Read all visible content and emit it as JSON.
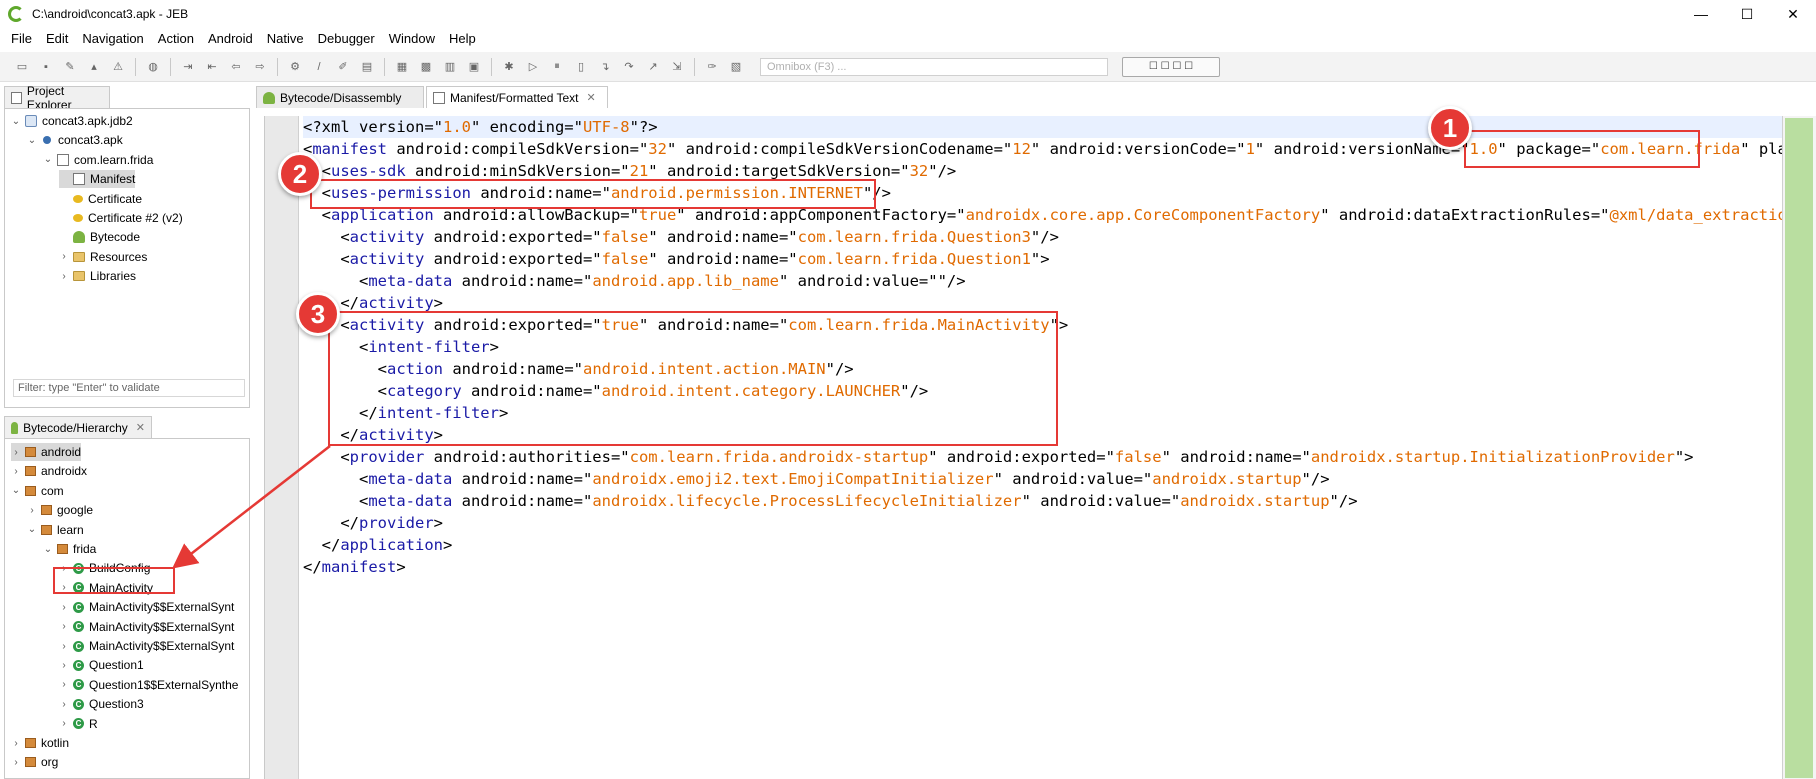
{
  "window": {
    "title": "C:\\android\\concat3.apk - JEB",
    "minimize": "—",
    "maximize": "☐",
    "close": "✕"
  },
  "menu": [
    "File",
    "Edit",
    "Navigation",
    "Action",
    "Android",
    "Native",
    "Debugger",
    "Window",
    "Help"
  ],
  "toolbar": {
    "omnibox_placeholder": "Omnibox (F3) ...",
    "button_label": "☐ ☐ ☐ ☐"
  },
  "project_explorer": {
    "tab_label": "Project Explorer",
    "filter_placeholder": "Filter: type \"Enter\" to validate",
    "items": [
      {
        "label": "concat3.apk.jdb2",
        "icon": "db-icon",
        "depth": 0,
        "chevron": "v"
      },
      {
        "label": "concat3.apk",
        "icon": "apk-icon",
        "depth": 1,
        "chevron": "v"
      },
      {
        "label": "com.learn.frida",
        "icon": "file-icon",
        "depth": 2,
        "chevron": "v"
      },
      {
        "label": "Manifest",
        "icon": "manifest-icon",
        "depth": 3,
        "chevron": "",
        "selected": true
      },
      {
        "label": "Certificate",
        "icon": "certificate-icon",
        "depth": 3,
        "chevron": ""
      },
      {
        "label": "Certificate #2 (v2)",
        "icon": "certificate-icon",
        "depth": 3,
        "chevron": ""
      },
      {
        "label": "Bytecode",
        "icon": "android-icon",
        "depth": 3,
        "chevron": ""
      },
      {
        "label": "Resources",
        "icon": "folder-icon",
        "depth": 3,
        "chevron": ">"
      },
      {
        "label": "Libraries",
        "icon": "folder-icon",
        "depth": 3,
        "chevron": ">"
      }
    ]
  },
  "hierarchy": {
    "tab_label": "Bytecode/Hierarchy",
    "items": [
      {
        "label": "android",
        "icon": "package-icon",
        "depth": 0,
        "chevron": ">",
        "selected": true
      },
      {
        "label": "androidx",
        "icon": "package-icon",
        "depth": 0,
        "chevron": ">"
      },
      {
        "label": "com",
        "icon": "package-icon",
        "depth": 0,
        "chevron": "v"
      },
      {
        "label": "google",
        "icon": "package-icon",
        "depth": 1,
        "chevron": ">"
      },
      {
        "label": "learn",
        "icon": "package-icon",
        "depth": 1,
        "chevron": "v"
      },
      {
        "label": "frida",
        "icon": "package-icon",
        "depth": 2,
        "chevron": "v"
      },
      {
        "label": "BuildConfig",
        "icon": "class-icon",
        "depth": 3,
        "chevron": ">"
      },
      {
        "label": "MainActivity",
        "icon": "class-icon",
        "depth": 3,
        "chevron": ">"
      },
      {
        "label": "MainActivity$$ExternalSynt",
        "icon": "class-icon",
        "depth": 3,
        "chevron": ">"
      },
      {
        "label": "MainActivity$$ExternalSynt",
        "icon": "class-icon",
        "depth": 3,
        "chevron": ">"
      },
      {
        "label": "MainActivity$$ExternalSynt",
        "icon": "class-icon",
        "depth": 3,
        "chevron": ">"
      },
      {
        "label": "Question1",
        "icon": "class-icon",
        "depth": 3,
        "chevron": ">"
      },
      {
        "label": "Question1$$ExternalSynthe",
        "icon": "class-icon",
        "depth": 3,
        "chevron": ">"
      },
      {
        "label": "Question3",
        "icon": "class-icon",
        "depth": 3,
        "chevron": ">"
      },
      {
        "label": "R",
        "icon": "class-icon",
        "depth": 3,
        "chevron": ">"
      },
      {
        "label": "kotlin",
        "icon": "package-icon",
        "depth": 0,
        "chevron": ">"
      },
      {
        "label": "org",
        "icon": "package-icon",
        "depth": 0,
        "chevron": ">"
      }
    ]
  },
  "editor_tabs": [
    {
      "label": "Bytecode/Disassembly",
      "icon": "android-icon"
    },
    {
      "label": "Manifest/Formatted Text",
      "icon": "manifest-icon",
      "close": "✕",
      "active": true
    }
  ],
  "code_lines": [
    [
      {
        "t": "<?xml version=\"",
        "c": ""
      },
      {
        "t": "1.0",
        "c": "val"
      },
      {
        "t": "\" encoding=\"",
        "c": ""
      },
      {
        "t": "UTF-8",
        "c": "val"
      },
      {
        "t": "\"?>",
        "c": ""
      }
    ],
    [
      {
        "t": "<",
        "c": ""
      },
      {
        "t": "manifest",
        "c": "tag"
      },
      {
        "t": " android:compileSdkVersion=\"",
        "c": ""
      },
      {
        "t": "32",
        "c": "val"
      },
      {
        "t": "\" android:compileSdkVersionCodename=\"",
        "c": ""
      },
      {
        "t": "12",
        "c": "val"
      },
      {
        "t": "\" android:versionCode=\"",
        "c": ""
      },
      {
        "t": "1",
        "c": "val"
      },
      {
        "t": "\" android:versionName=\"",
        "c": ""
      },
      {
        "t": "1.0",
        "c": "val"
      },
      {
        "t": "\" package=\"",
        "c": ""
      },
      {
        "t": "com.learn.frida",
        "c": "val"
      },
      {
        "t": "\" platform",
        "c": ""
      }
    ],
    [
      {
        "t": "  <",
        "c": ""
      },
      {
        "t": "uses-sdk",
        "c": "tag"
      },
      {
        "t": " android:minSdkVersion=\"",
        "c": ""
      },
      {
        "t": "21",
        "c": "val"
      },
      {
        "t": "\" android:targetSdkVersion=\"",
        "c": ""
      },
      {
        "t": "32",
        "c": "val"
      },
      {
        "t": "\"/>",
        "c": ""
      }
    ],
    [
      {
        "t": "  <",
        "c": ""
      },
      {
        "t": "uses-permission",
        "c": "tag"
      },
      {
        "t": " android:name=\"",
        "c": ""
      },
      {
        "t": "android.permission.INTERNET",
        "c": "val"
      },
      {
        "t": "\"/>",
        "c": ""
      }
    ],
    [
      {
        "t": "  <",
        "c": ""
      },
      {
        "t": "application",
        "c": "tag"
      },
      {
        "t": " android:allowBackup=\"",
        "c": ""
      },
      {
        "t": "true",
        "c": "val"
      },
      {
        "t": "\" android:appComponentFactory=\"",
        "c": ""
      },
      {
        "t": "androidx.core.app.CoreComponentFactory",
        "c": "val"
      },
      {
        "t": "\" android:dataExtractionRules=\"",
        "c": ""
      },
      {
        "t": "@xml/data_extraction_rul",
        "c": "val"
      }
    ],
    [
      {
        "t": "    <",
        "c": ""
      },
      {
        "t": "activity",
        "c": "tag"
      },
      {
        "t": " android:exported=\"",
        "c": ""
      },
      {
        "t": "false",
        "c": "val"
      },
      {
        "t": "\" android:name=\"",
        "c": ""
      },
      {
        "t": "com.learn.frida.Question3",
        "c": "val"
      },
      {
        "t": "\"/>",
        "c": ""
      }
    ],
    [
      {
        "t": "    <",
        "c": ""
      },
      {
        "t": "activity",
        "c": "tag"
      },
      {
        "t": " android:exported=\"",
        "c": ""
      },
      {
        "t": "false",
        "c": "val"
      },
      {
        "t": "\" android:name=\"",
        "c": ""
      },
      {
        "t": "com.learn.frida.Question1",
        "c": "val"
      },
      {
        "t": "\">",
        "c": ""
      }
    ],
    [
      {
        "t": "      <",
        "c": ""
      },
      {
        "t": "meta-data",
        "c": "tag"
      },
      {
        "t": " android:name=\"",
        "c": ""
      },
      {
        "t": "android.app.lib_name",
        "c": "val"
      },
      {
        "t": "\" android:value=\"\"/>",
        "c": ""
      }
    ],
    [
      {
        "t": "    </",
        "c": ""
      },
      {
        "t": "activity",
        "c": "tag"
      },
      {
        "t": ">",
        "c": ""
      }
    ],
    [
      {
        "t": "    <",
        "c": ""
      },
      {
        "t": "activity",
        "c": "tag"
      },
      {
        "t": " android:exported=\"",
        "c": ""
      },
      {
        "t": "true",
        "c": "val"
      },
      {
        "t": "\" android:name=\"",
        "c": ""
      },
      {
        "t": "com.learn.frida.MainActivity",
        "c": "val"
      },
      {
        "t": "\">",
        "c": ""
      }
    ],
    [
      {
        "t": "      <",
        "c": ""
      },
      {
        "t": "intent-filter",
        "c": "tag"
      },
      {
        "t": ">",
        "c": ""
      }
    ],
    [
      {
        "t": "        <",
        "c": ""
      },
      {
        "t": "action",
        "c": "tag"
      },
      {
        "t": " android:name=\"",
        "c": ""
      },
      {
        "t": "android.intent.action.MAIN",
        "c": "val"
      },
      {
        "t": "\"/>",
        "c": ""
      }
    ],
    [
      {
        "t": "        <",
        "c": ""
      },
      {
        "t": "category",
        "c": "tag"
      },
      {
        "t": " android:name=\"",
        "c": ""
      },
      {
        "t": "android.intent.category.LAUNCHER",
        "c": "val"
      },
      {
        "t": "\"/>",
        "c": ""
      }
    ],
    [
      {
        "t": "      </",
        "c": ""
      },
      {
        "t": "intent-filter",
        "c": "tag"
      },
      {
        "t": ">",
        "c": ""
      }
    ],
    [
      {
        "t": "    </",
        "c": ""
      },
      {
        "t": "activity",
        "c": "tag"
      },
      {
        "t": ">",
        "c": ""
      }
    ],
    [
      {
        "t": "    <",
        "c": ""
      },
      {
        "t": "provider",
        "c": "tag"
      },
      {
        "t": " android:authorities=\"",
        "c": ""
      },
      {
        "t": "com.learn.frida.androidx-startup",
        "c": "val"
      },
      {
        "t": "\" android:exported=\"",
        "c": ""
      },
      {
        "t": "false",
        "c": "val"
      },
      {
        "t": "\" android:name=\"",
        "c": ""
      },
      {
        "t": "androidx.startup.InitializationProvider",
        "c": "val"
      },
      {
        "t": "\">",
        "c": ""
      }
    ],
    [
      {
        "t": "      <",
        "c": ""
      },
      {
        "t": "meta-data",
        "c": "tag"
      },
      {
        "t": " android:name=\"",
        "c": ""
      },
      {
        "t": "androidx.emoji2.text.EmojiCompatInitializer",
        "c": "val"
      },
      {
        "t": "\" android:value=\"",
        "c": ""
      },
      {
        "t": "androidx.startup",
        "c": "val"
      },
      {
        "t": "\"/>",
        "c": ""
      }
    ],
    [
      {
        "t": "      <",
        "c": ""
      },
      {
        "t": "meta-data",
        "c": "tag"
      },
      {
        "t": " android:name=\"",
        "c": ""
      },
      {
        "t": "androidx.lifecycle.ProcessLifecycleInitializer",
        "c": "val"
      },
      {
        "t": "\" android:value=\"",
        "c": ""
      },
      {
        "t": "androidx.startup",
        "c": "val"
      },
      {
        "t": "\"/>",
        "c": ""
      }
    ],
    [
      {
        "t": "    </",
        "c": ""
      },
      {
        "t": "provider",
        "c": "tag"
      },
      {
        "t": ">",
        "c": ""
      }
    ],
    [
      {
        "t": "  </",
        "c": ""
      },
      {
        "t": "application",
        "c": "tag"
      },
      {
        "t": ">",
        "c": ""
      }
    ],
    [
      {
        "t": "</",
        "c": ""
      },
      {
        "t": "manifest",
        "c": "tag"
      },
      {
        "t": ">",
        "c": ""
      }
    ]
  ],
  "annotations": {
    "badge_1": "1",
    "badge_2": "2",
    "badge_3": "3"
  },
  "colors": {
    "tag": "#1a1aa6",
    "value": "#e06a00",
    "annotation_red": "#e53935"
  }
}
